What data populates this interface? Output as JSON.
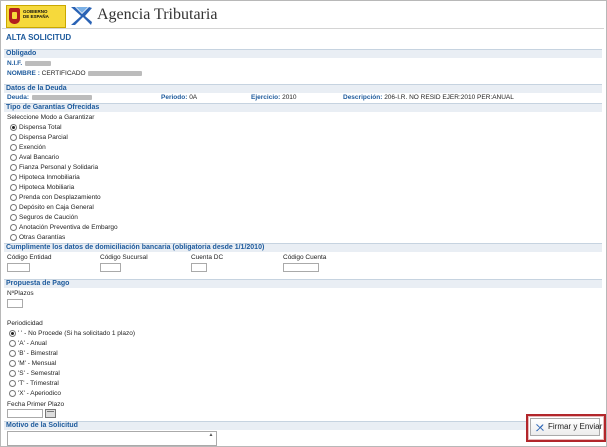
{
  "header": {
    "gov_logo_text": [
      "GOBIERNO",
      "DE ESPAÑA"
    ],
    "agency_name": "Agencia Tributaria"
  },
  "page_title": "ALTA SOLICITUD",
  "obligado": {
    "section_label": "Obligado",
    "nif_label": "N.I.F.",
    "nombre_label": "NOMBRE :",
    "nombre_value": "CERTIFICADO"
  },
  "deuda": {
    "section_label": "Datos de la Deuda",
    "deuda_label": "Deuda:",
    "periodo_label": "Periodo:",
    "periodo_value": "0A",
    "ejercicio_label": "Ejercicio:",
    "ejercicio_value": "2010",
    "descripcion_label": "Descripción:",
    "descripcion_value": "206-I.R. NO RESID EJER:2010 PER:ANUAL"
  },
  "garantias": {
    "section_label": "Tipo de Garantías Ofrecidas",
    "prompt": "Seleccione Modo a Garantizar",
    "options": [
      "Dispensa Total",
      "Dispensa Parcial",
      "Exención",
      "Aval Bancario",
      "Fianza Personal y Solidaria",
      "Hipoteca Inmobiliaria",
      "Hipoteca Mobiliaria",
      "Prenda con Desplazamiento",
      "Depósito en Caja General",
      "Seguros de Caución",
      "Anotación Preventiva de Embargo",
      "Otras Garantías"
    ],
    "selected_index": 0
  },
  "domiciliacion": {
    "section_label": "Cumplimente los datos de domiciliación bancaria (obligatoria desde 1/1/2010)",
    "labels": [
      "Código Entidad",
      "Código Sucursal",
      "Cuenta DC",
      "Código Cuenta"
    ]
  },
  "propuesta": {
    "section_label": "Propuesta de Pago",
    "plazos_label": "NºPlazos",
    "periodicidad_label": "Periodicidad",
    "options": [
      "' ' - No Procede (Si ha solicitado 1 plazo)",
      "'A' - Anual",
      "'B' - Bimestral",
      "'M' - Mensual",
      "'S' - Semestral",
      "'T' - Trimestral",
      "'X' - Aperiodico"
    ],
    "selected_index": 0,
    "fecha_label": "Fecha Primer Plazo"
  },
  "motivo": {
    "section_label": "Motivo de la Solicitud"
  },
  "actions": {
    "submit_label": "Firmar y Enviar"
  },
  "colors": {
    "section_text": "#1d5a9c",
    "highlight_border": "#b2262b"
  }
}
